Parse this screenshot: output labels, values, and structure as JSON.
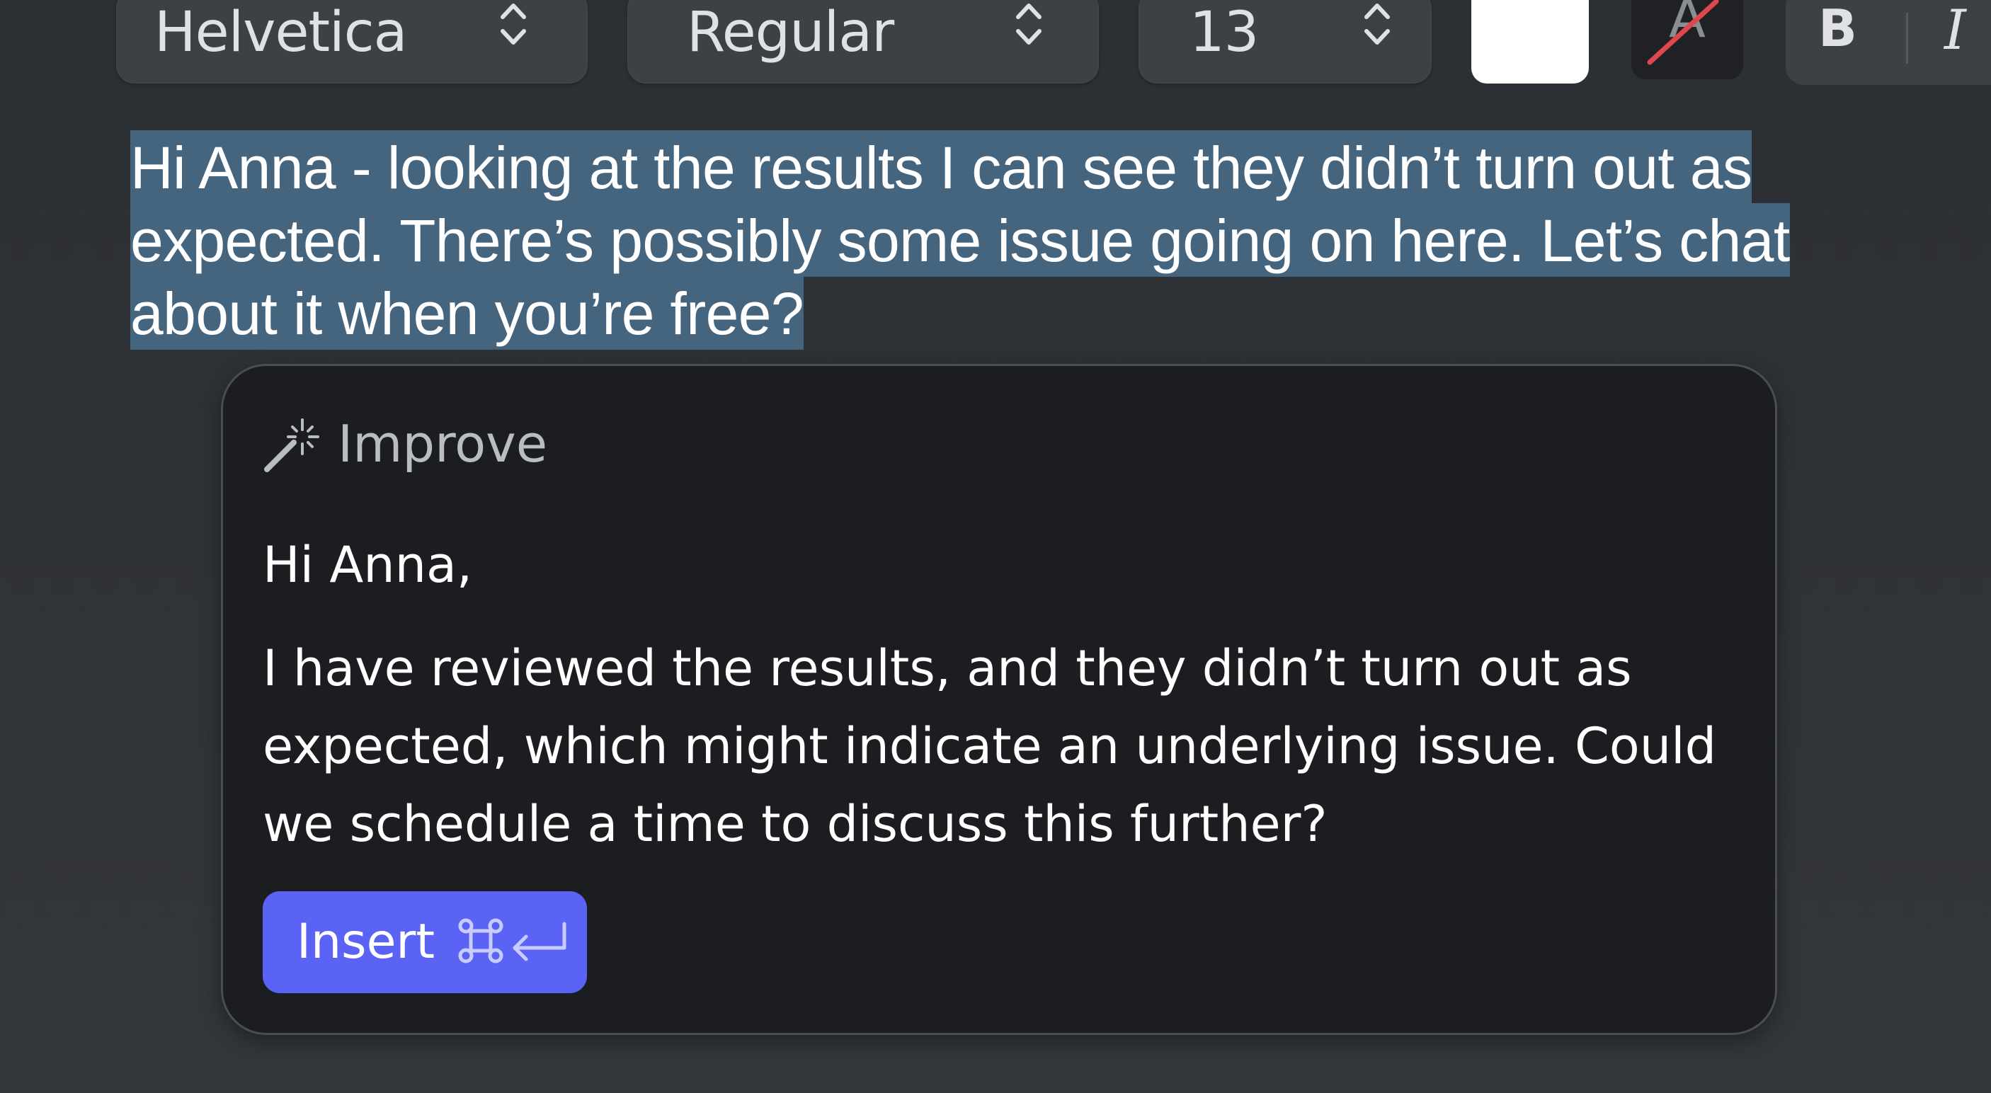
{
  "toolbar": {
    "font_family": "Helvetica",
    "font_style": "Regular",
    "font_size": "13",
    "text_color": "#ffffff",
    "strikethrough_glyph": "A",
    "bold_label": "B",
    "italic_label": "I"
  },
  "editor": {
    "selected_text": "Hi Anna - looking at the results I can see they didn’t turn out as expected. There’s possibly some issue going on here. Let’s chat about it when you’re free?",
    "selection_color": "#45657f"
  },
  "improve_panel": {
    "title": "Improve",
    "icon": "magic-wand-icon",
    "suggestion_greeting": "Hi Anna,",
    "suggestion_body": "I have reviewed the results, and they didn’t turn out as expected, which might indicate an underlying issue. Could we schedule a time to discuss this further?",
    "insert_label": "Insert",
    "insert_shortcut_icons": [
      "command-key-icon",
      "return-key-icon"
    ],
    "accent_color": "#5b63f5"
  }
}
